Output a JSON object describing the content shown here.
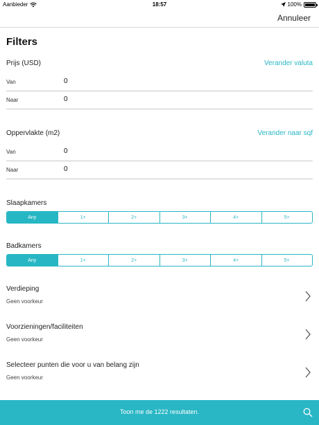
{
  "status": {
    "carrier": "Aanbieder",
    "time": "18:57",
    "battery": "100%",
    "battery_level": 1.0
  },
  "nav": {
    "cancel": "Annuleer"
  },
  "title": "Filters",
  "price": {
    "heading": "Prijs (USD)",
    "action": "Verander valuta",
    "from_label": "Van",
    "from_value": "0",
    "to_label": "Naar",
    "to_value": "0"
  },
  "area": {
    "heading": "Oppervlakte (m2)",
    "action": "Verander naar sqf",
    "from_label": "Van",
    "from_value": "0",
    "to_label": "Naar",
    "to_value": "0"
  },
  "bedrooms": {
    "label": "Slaapkamers",
    "options": [
      "Any",
      "1+",
      "2+",
      "3+",
      "4+",
      "5+"
    ],
    "selected": "Any"
  },
  "bathrooms": {
    "label": "Badkamers",
    "options": [
      "Any",
      "1+",
      "2+",
      "3+",
      "4+",
      "5+"
    ],
    "selected": "Any"
  },
  "rows": [
    {
      "title": "Verdieping",
      "sub": "Geen voorkeur"
    },
    {
      "title": "Voorzieningen/faciliteiten",
      "sub": "Geen voorkeur"
    },
    {
      "title": "Selecteer punten die voor u van belang zijn",
      "sub": "Geen voorkeur"
    }
  ],
  "footer": {
    "label": "Toon me de 1222 resultaten."
  },
  "colors": {
    "accent": "#27b7c4",
    "footer": "#29b6c5"
  },
  "icons": [
    "wifi-icon",
    "location-arrow-icon",
    "battery-icon",
    "chevron-right-icon",
    "search-icon"
  ]
}
